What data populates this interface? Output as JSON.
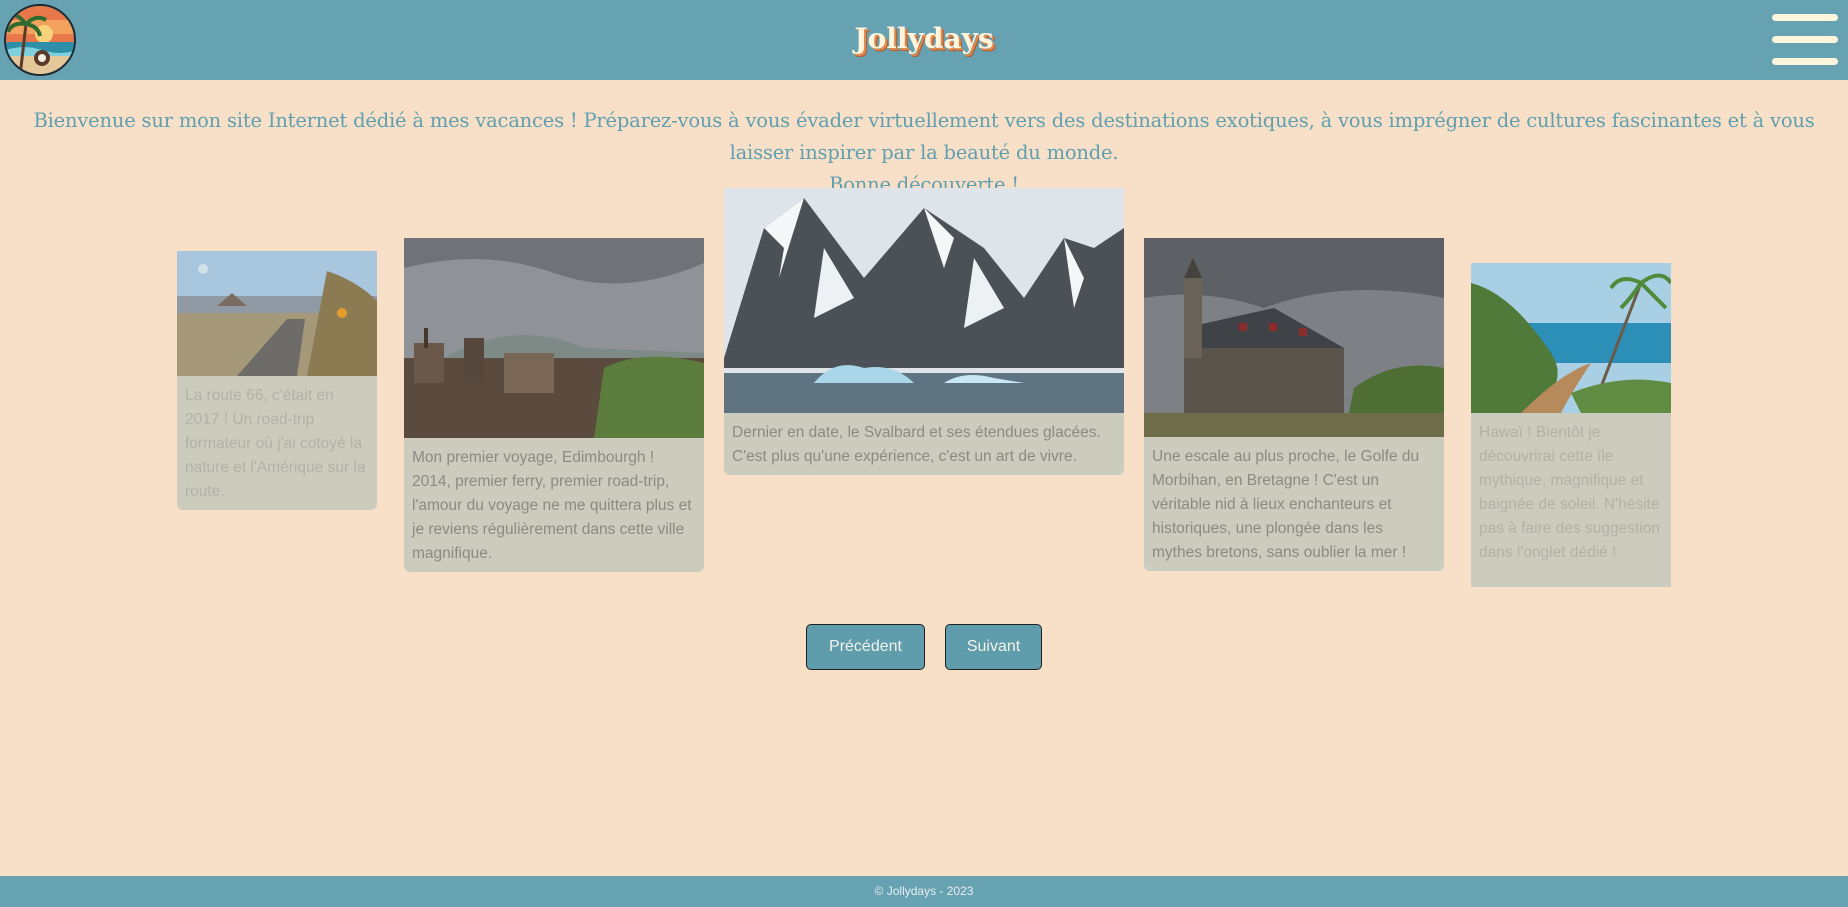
{
  "header": {
    "brand": "Jollydays",
    "logo_icon": "tropical-beach-logo-icon",
    "menu_icon": "hamburger-menu-icon"
  },
  "intro": {
    "line1": "Bienvenue sur mon site Internet dédié à mes vacances ! Préparez-vous à vous évader virtuellement vers des destinations exotiques, à vous imprégner de cultures fascinantes et à vous laisser inspirer par la beauté du monde.",
    "line2": "Bonne découverte !"
  },
  "carousel": {
    "cards": [
      {
        "image": "route-66-desert-road-photo",
        "text": "La route 66, c'était en 2017 ! Un road-trip formateur où j'ai cotoyé la nature et l'Amérique sur la route."
      },
      {
        "image": "edinburgh-city-photo",
        "text": "Mon premier voyage, Edimbourgh ! 2014, premier ferry, premier road-trip, l'amour du voyage ne me quittera plus et je reviens régulièrement dans cette ville magnifique."
      },
      {
        "image": "svalbard-glacier-photo",
        "text": "Dernier en date, le Svalbard et ses étendues glacées. C'est plus qu'une expérience, c'est un art de vivre."
      },
      {
        "image": "morbihan-chapel-photo",
        "text": "Une escale au plus proche, le Golfe du Morbihan, en Bretagne ! C'est un véritable nid à lieux enchanteurs et historiques, une plongée dans les mythes bretons, sans oublier la mer !"
      },
      {
        "image": "hawaii-coast-trail-photo",
        "text": "Hawaï ! Bientôt je découvrirai cette île mythique, magnifique et baignée de soleil. N'hésite pas à faire des suggestion dans l'onglet dédié !"
      }
    ],
    "prev_label": "Précédent",
    "next_label": "Suivant"
  },
  "footer": {
    "copyright": "© Jollydays - 2023"
  },
  "colors": {
    "background": "#f8e0c8",
    "header": "#66a2b2",
    "accent_text": "#5f9fb0",
    "card": "#cbcbbe",
    "button": "#5f9dad"
  }
}
